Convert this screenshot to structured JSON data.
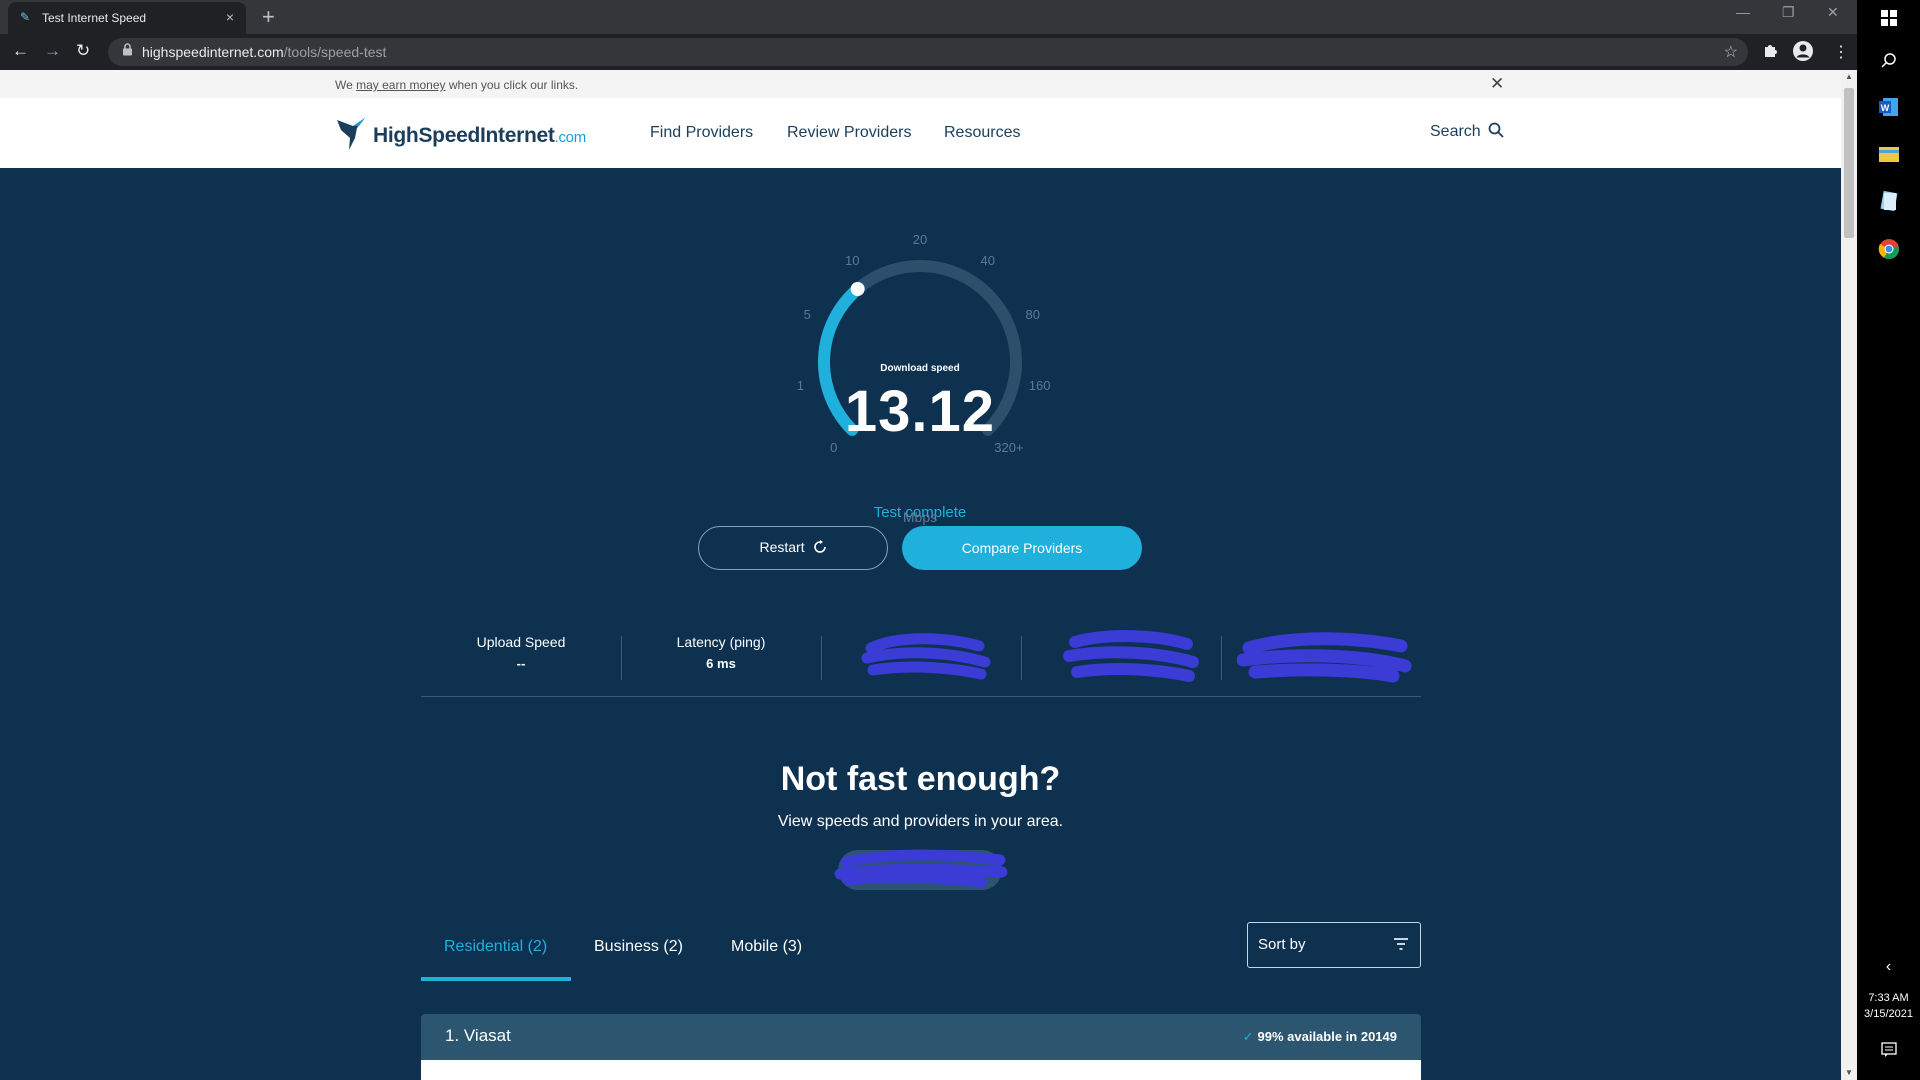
{
  "browser": {
    "tab_title": "Test Internet Speed",
    "tab_close": "×",
    "new_tab": "+",
    "url_host": "highspeedinternet.com",
    "url_path": "/tools/speed-test",
    "window_min": "—",
    "window_restore": "❐",
    "window_close": "✕"
  },
  "disclosure": {
    "prefix": "We ",
    "link": "may earn money",
    "suffix": " when you click our links.",
    "close": "✕"
  },
  "site": {
    "logo_main": "HighSpeedInternet",
    "logo_tld": ".com",
    "nav": [
      "Find Providers",
      "Review Providers",
      "Resources"
    ],
    "search_label": "Search"
  },
  "gauge": {
    "title": "Download speed",
    "value": "13.12",
    "unit": "Mbps",
    "status": "Test complete",
    "ticks": [
      "0",
      "1",
      "5",
      "10",
      "20",
      "40",
      "80",
      "160",
      "320+"
    ],
    "progress_fraction": 0.35,
    "colors": {
      "track": "#2c4f6b",
      "fill": "#1fb0dc"
    }
  },
  "actions": {
    "restart": "Restart",
    "compare": "Compare Providers"
  },
  "stats": {
    "upload_label": "Upload Speed",
    "upload_value": "--",
    "latency_label": "Latency (ping)",
    "latency_value": "6 ms"
  },
  "promo": {
    "headline": "Not fast enough?",
    "subline": "View speeds and providers in your area."
  },
  "provider_tabs": [
    "Residential (2)",
    "Business (2)",
    "Mobile (3)"
  ],
  "sort": {
    "label": "Sort by"
  },
  "provider": {
    "name": "1. Viasat",
    "availability": "99% available in 20149"
  },
  "taskbar": {
    "time": "7:33 AM",
    "date": "3/15/2021"
  },
  "colors": {
    "page_bg": "#0e3150",
    "accent": "#1fb0dc",
    "redaction": "#3b3bd6"
  }
}
